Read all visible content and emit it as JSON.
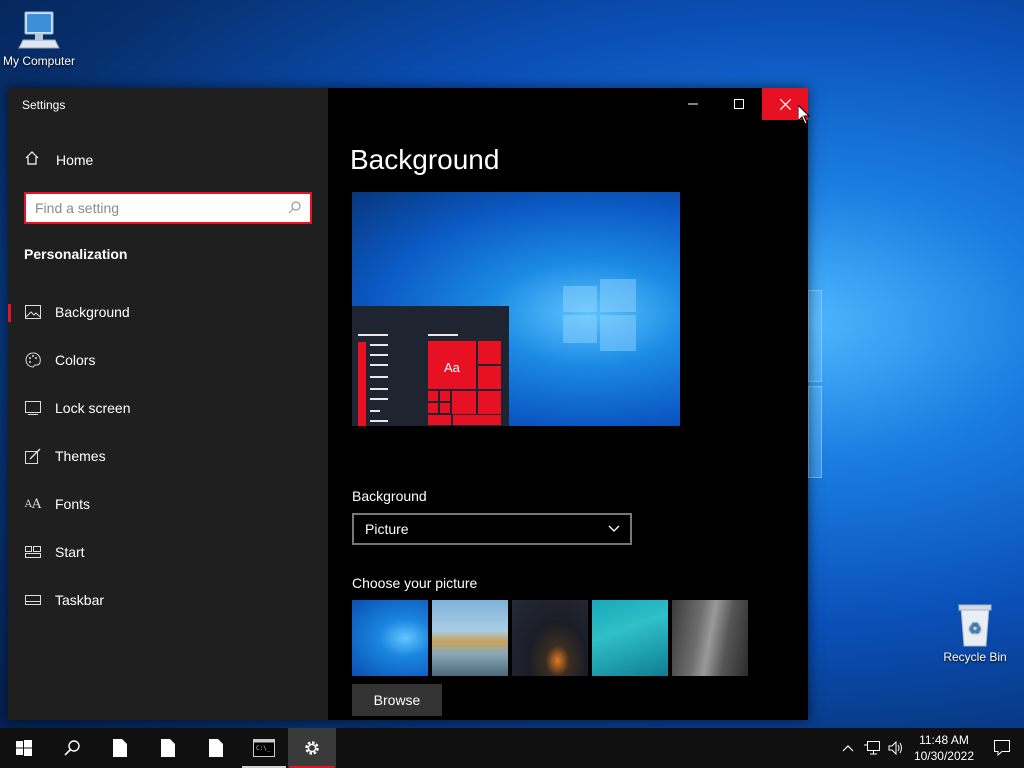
{
  "desktop": {
    "icons": [
      {
        "label": "My Computer",
        "icon": "computer-icon"
      },
      {
        "label": "Recycle Bin",
        "icon": "recycle-bin-icon"
      }
    ]
  },
  "window": {
    "title": "Settings",
    "controls": {
      "minimize": "minimize-icon",
      "maximize": "maximize-icon",
      "close": "close-icon"
    }
  },
  "sidebar": {
    "home_label": "Home",
    "search_placeholder": "Find a setting",
    "section_title": "Personalization",
    "items": [
      {
        "label": "Background",
        "icon": "picture-icon",
        "active": true
      },
      {
        "label": "Colors",
        "icon": "palette-icon",
        "active": false
      },
      {
        "label": "Lock screen",
        "icon": "lock-screen-icon",
        "active": false
      },
      {
        "label": "Themes",
        "icon": "themes-brush-icon",
        "active": false
      },
      {
        "label": "Fonts",
        "icon": "fonts-icon",
        "active": false
      },
      {
        "label": "Start",
        "icon": "start-layout-icon",
        "active": false
      },
      {
        "label": "Taskbar",
        "icon": "taskbar-icon",
        "active": false
      }
    ]
  },
  "main": {
    "page_title": "Background",
    "preview_tile_text": "Aa",
    "background_label": "Background",
    "background_value": "Picture",
    "choose_picture_label": "Choose your picture",
    "pictures": [
      "windows-10-hero",
      "beach-rock-arch",
      "night-sky-tent",
      "underwater-swimmer",
      "cliff-rock-face"
    ],
    "browse_label": "Browse"
  },
  "taskbar": {
    "buttons": [
      "start-icon",
      "search-icon",
      "file-icon",
      "file-icon",
      "file-icon",
      "terminal-icon",
      "settings-gear-icon"
    ],
    "clock_time": "11:48 AM",
    "clock_date": "10/30/2022"
  },
  "colors": {
    "accent": "#e81123",
    "sidebar_bg": "#1f1f1f",
    "content_bg": "#000000",
    "taskbar_bg": "#101010"
  }
}
